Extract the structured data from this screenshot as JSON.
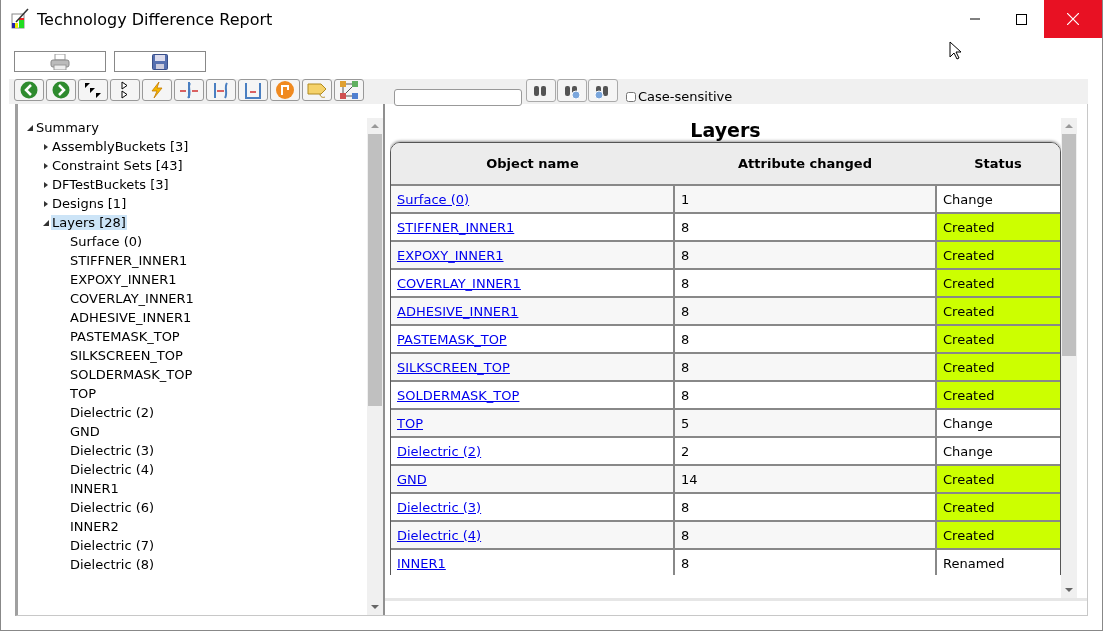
{
  "window": {
    "title": "Technology Difference Report"
  },
  "search": {
    "case_sensitive": {
      "label": "Case-sensitive",
      "checked": false
    }
  },
  "tree": [
    {
      "label": "Summary",
      "expanded": true,
      "selected": false,
      "children": [
        {
          "label": "AssemblyBuckets [3]",
          "expanded": false,
          "selected": false
        },
        {
          "label": "Constraint Sets [43]",
          "expanded": false,
          "selected": false
        },
        {
          "label": "DFTestBuckets [3]",
          "expanded": false,
          "selected": false
        },
        {
          "label": "Designs [1]",
          "expanded": false,
          "selected": false
        },
        {
          "label": "Layers [28]",
          "expanded": true,
          "selected": true,
          "children": [
            {
              "label": "Surface (0)",
              "selected": false
            },
            {
              "label": "STIFFNER_INNER1",
              "selected": false
            },
            {
              "label": "EXPOXY_INNER1",
              "selected": false
            },
            {
              "label": "COVERLAY_INNER1",
              "selected": false
            },
            {
              "label": "ADHESIVE_INNER1",
              "selected": false
            },
            {
              "label": "PASTEMASK_TOP",
              "selected": false
            },
            {
              "label": "SILKSCREEN_TOP",
              "selected": false
            },
            {
              "label": "SOLDERMASK_TOP",
              "selected": false
            },
            {
              "label": "TOP",
              "selected": false
            },
            {
              "label": "Dielectric (2)",
              "selected": false
            },
            {
              "label": "GND",
              "selected": false
            },
            {
              "label": "Dielectric (3)",
              "selected": false
            },
            {
              "label": "Dielectric (4)",
              "selected": false
            },
            {
              "label": "INNER1",
              "selected": false
            },
            {
              "label": "Dielectric (6)",
              "selected": false
            },
            {
              "label": "INNER2",
              "selected": false
            },
            {
              "label": "Dielectric (7)",
              "selected": false
            },
            {
              "label": "Dielectric (8)",
              "selected": false
            }
          ]
        }
      ]
    }
  ],
  "report": {
    "title": "Layers",
    "columns": [
      "Object name",
      "Attribute changed",
      "Status"
    ],
    "rows": [
      {
        "name": "Surface (0)",
        "attribute": "1",
        "status": "Change"
      },
      {
        "name": "STIFFNER_INNER1",
        "attribute": "8",
        "status": "Created",
        "color": "#ccff00"
      },
      {
        "name": "EXPOXY_INNER1",
        "attribute": "8",
        "status": "Created",
        "color": "#ccff00"
      },
      {
        "name": "COVERLAY_INNER1",
        "attribute": "8",
        "status": "Created",
        "color": "#ccff00"
      },
      {
        "name": "ADHESIVE_INNER1",
        "attribute": "8",
        "status": "Created",
        "color": "#ccff00"
      },
      {
        "name": "PASTEMASK_TOP",
        "attribute": "8",
        "status": "Created",
        "color": "#ccff00"
      },
      {
        "name": "SILKSCREEN_TOP",
        "attribute": "8",
        "status": "Created",
        "color": "#ccff00"
      },
      {
        "name": "SOLDERMASK_TOP",
        "attribute": "8",
        "status": "Created",
        "color": "#ccff00"
      },
      {
        "name": "TOP",
        "attribute": "5",
        "status": "Change"
      },
      {
        "name": "Dielectric (2)",
        "attribute": "2",
        "status": "Change"
      },
      {
        "name": "GND",
        "attribute": "14",
        "status": "Created",
        "color": "#ccff00"
      },
      {
        "name": "Dielectric (3)",
        "attribute": "8",
        "status": "Created",
        "color": "#ccff00"
      },
      {
        "name": "Dielectric (4)",
        "attribute": "8",
        "status": "Created",
        "color": "#ccff00"
      },
      {
        "name": "INNER1",
        "attribute": "8",
        "status": "Renamed"
      }
    ]
  }
}
